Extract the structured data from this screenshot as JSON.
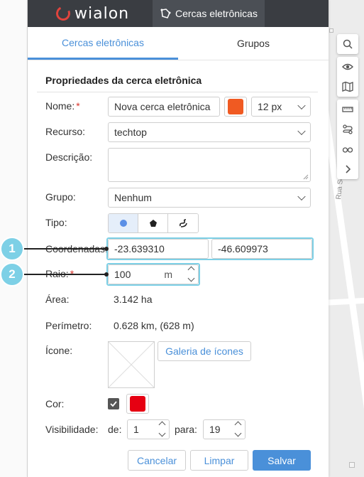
{
  "app": {
    "logo_text": "wialon",
    "active_app": "Cercas eletrônicas"
  },
  "tabs": [
    {
      "label": "Cercas eletrônicas",
      "active": true
    },
    {
      "label": "Grupos",
      "active": false
    }
  ],
  "section": {
    "title": "Propriedades da cerca eletrônica"
  },
  "form": {
    "name": {
      "label": "Nome:",
      "required": "*",
      "value": "Nova cerca eletrônica",
      "color": "#f05a22",
      "line_width": "12 px"
    },
    "resource": {
      "label": "Recurso:",
      "value": "techtop"
    },
    "description": {
      "label": "Descrição:",
      "value": ""
    },
    "group": {
      "label": "Grupo:",
      "value": "Nenhum"
    },
    "type": {
      "label": "Tipo:",
      "options": [
        "circle-icon",
        "polygon-icon",
        "line-icon"
      ],
      "selected": 0
    },
    "coordinates": {
      "label": "Coordenadas:",
      "lat": "-23.639310",
      "lon": "-46.609973"
    },
    "radius": {
      "label": "Raio:",
      "required": "*",
      "value": "100",
      "unit": "m"
    },
    "area": {
      "label": "Área:",
      "value": "3.142 ha"
    },
    "perimeter": {
      "label": "Perímetro:",
      "value": "0.628 km, (628 m)"
    },
    "icon": {
      "label": "Ícone:",
      "gallery_button": "Galeria de ícones"
    },
    "color": {
      "label": "Cor:",
      "checked": true,
      "value": "#e60012"
    },
    "visibility": {
      "label": "Visibilidade:",
      "from_label": "de:",
      "from": "1",
      "to_label": "para:",
      "to": "19"
    }
  },
  "buttons": {
    "cancel": "Cancelar",
    "clear": "Limpar",
    "save": "Salvar"
  },
  "callouts": [
    "1",
    "2"
  ],
  "map": {
    "street_label": "Rua Sebastiano Mazzoni"
  },
  "map_tools": [
    "search-icon",
    "eye-icon",
    "map-icon",
    "ruler-icon",
    "route-icon",
    "glasses-icon",
    "chevron-right-icon"
  ]
}
